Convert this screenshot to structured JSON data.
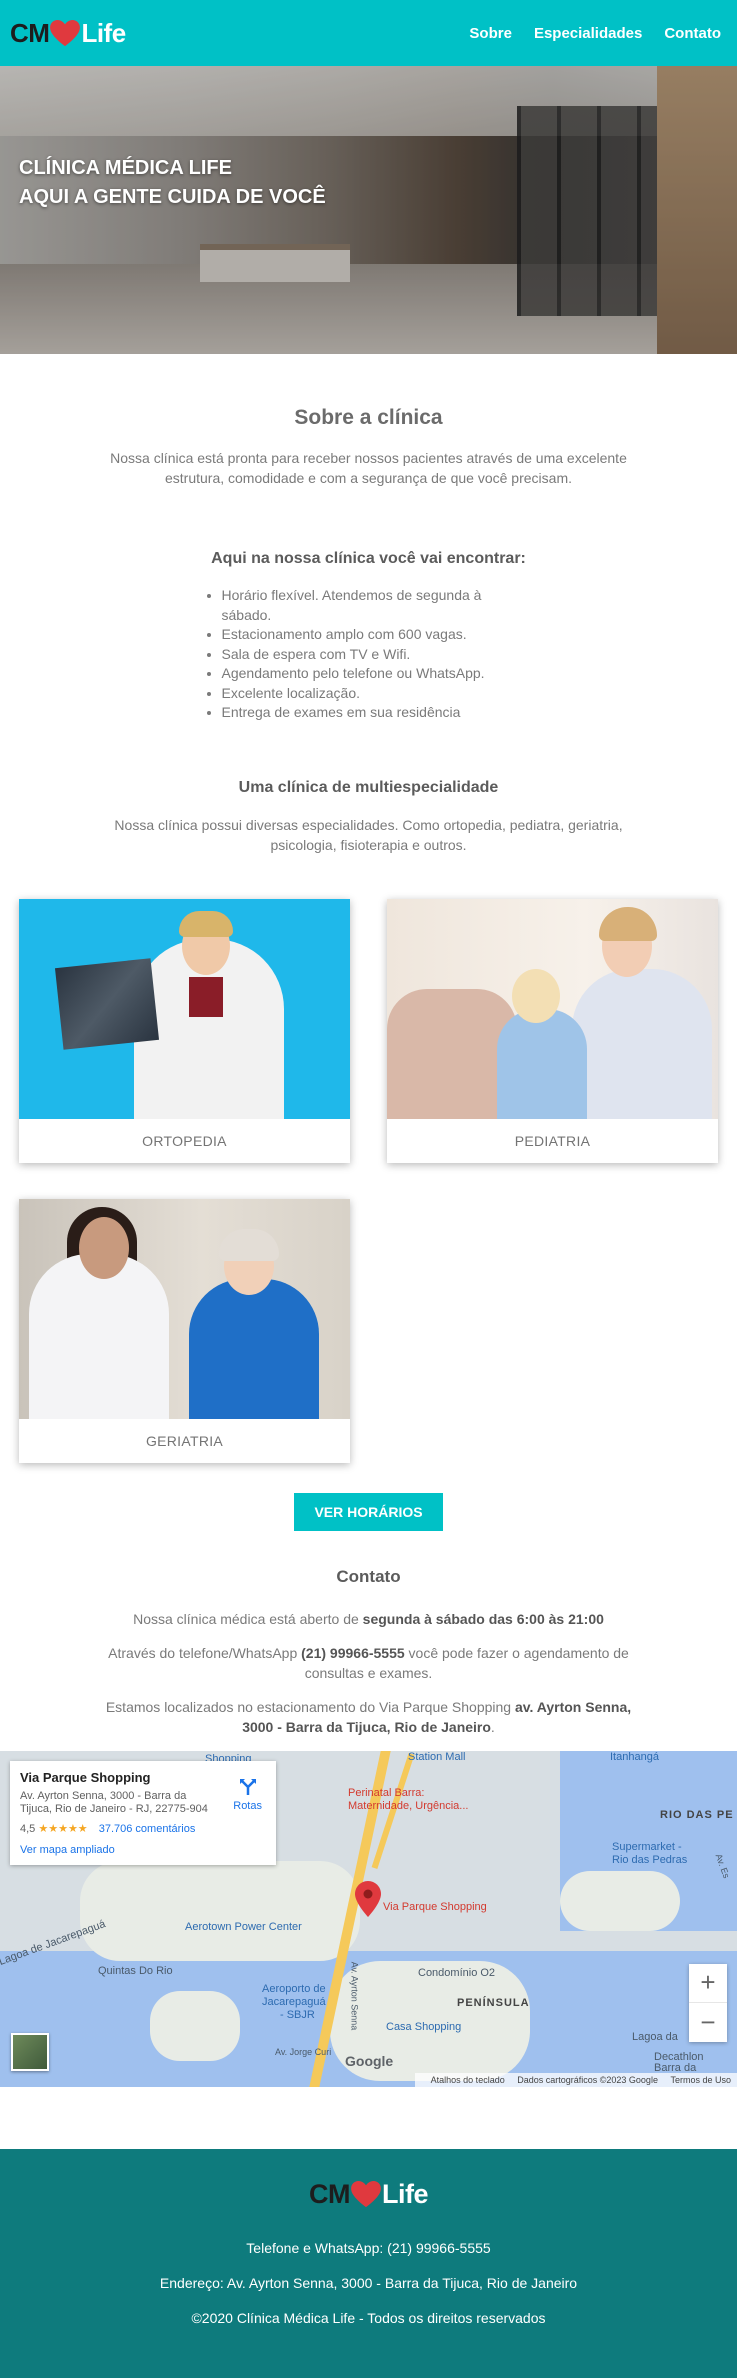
{
  "header": {
    "logo_cm": "CM",
    "logo_life": "Life",
    "nav": [
      "Sobre",
      "Especialidades",
      "Contato"
    ]
  },
  "hero": {
    "line1": "CLÍNICA MÉDICA LIFE",
    "line2": "AQUI A GENTE CUIDA DE VOCÊ"
  },
  "about": {
    "title": "Sobre a clínica",
    "text": "Nossa clínica está pronta para receber nossos pacientes através de uma excelente estrutura, comodidade e com a segurança de que você precisam."
  },
  "features": {
    "title": "Aqui na nossa clínica você vai encontrar:",
    "items": [
      "Horário flexível. Atendemos de segunda à sábado.",
      "Estacionamento amplo com 600 vagas.",
      "Sala de espera com TV e Wifi.",
      "Agendamento pelo telefone ou WhatsApp.",
      "Excelente localização.",
      "Entrega de exames em sua residência"
    ]
  },
  "multi": {
    "title": "Uma clínica de multiespecialidade",
    "text": "Nossa clínica possui diversas especialidades. Como ortopedia, pediatra, geriatria, psicologia, fisioterapia e outros."
  },
  "cards": [
    "ORTOPEDIA",
    "PEDIATRIA",
    "GERIATRIA"
  ],
  "button": {
    "label": "VER HORÁRIOS"
  },
  "contact": {
    "title": "Contato",
    "p1_pre": "Nossa clínica médica está aberto de ",
    "p1_bold": "segunda à sábado das 6:00 às 21:00",
    "p2_pre": "Através do telefone/WhatsApp ",
    "p2_bold": "(21) 99966-5555",
    "p2_post": " você pode fazer o agendamento de consultas e exames.",
    "p3_pre": "Estamos localizados no estacionamento do Via Parque Shopping ",
    "p3_bold": "av. Ayrton Senna, 3000 - Barra da Tijuca, Rio de Janeiro",
    "p3_post": "."
  },
  "map": {
    "place": "Via Parque Shopping",
    "address": "Av. Ayrton Senna, 3000 - Barra da Tijuca, Rio de Janeiro - RJ, 22775-904",
    "rating": "4,5",
    "stars": "★★★★★",
    "reviews": "37.706 comentários",
    "larger_map": "Ver mapa ampliado",
    "directions": "Rotas",
    "labels": {
      "shopping": "Shopping",
      "station_mall": "Station Mall",
      "itanhanga": "Itanhangá",
      "perinatal": "Perinatal Barra:",
      "perinatal2": "Maternidade, Urgência...",
      "rio_das_pedras": "RIO DAS PE",
      "supermarket": "Supermarket -",
      "supermarket2": "Rio das Pedras",
      "lagoa": "Lagoa de Jacarepaguá",
      "aerotown": "Aerotown Power Center",
      "via_parque": "Via Parque Shopping",
      "quintas": "Quintas Do Rio",
      "aeroporto": "Aeroporto de",
      "aeroporto2": "Jacarepaguá",
      "aeroporto3": "- SBJR",
      "condominio": "Condomínio O2",
      "peninsula": "PENÍNSULA",
      "casa_shopping": "Casa Shopping",
      "lagoa_da": "Lagoa da",
      "decathlon": "Decathlon",
      "barra_da": "Barra da",
      "av_jorge": "Av. Jorge Curi",
      "av_ayrton": "Av. Ayrton Senna",
      "av_es": "Av. Es"
    },
    "zoom_in": "+",
    "zoom_out": "−",
    "google": "Google",
    "attrib": [
      "Atalhos do teclado",
      "Dados cartográficos ©2023 Google",
      "Termos de Uso"
    ]
  },
  "footer": {
    "logo_cm": "CM",
    "logo_life": "Life",
    "phone": "Telefone e WhatsApp: (21) 99966-5555",
    "address": "Endereço: Av. Ayrton Senna, 3000 - Barra da Tijuca, Rio de Janeiro",
    "copyright": "©2020 Clínica Médica Life - Todos os direitos reservados"
  },
  "colors": {
    "accent": "#00c1c6",
    "footer": "#0e7b7d",
    "heart": "#e0393e"
  }
}
